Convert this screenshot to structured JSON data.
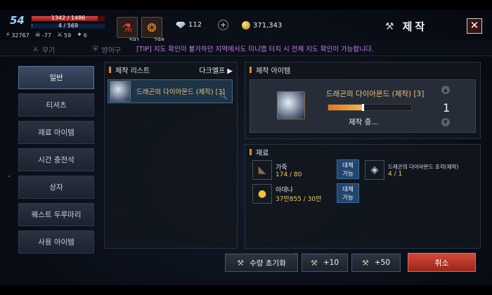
{
  "hud": {
    "level": "54",
    "hp": "1342 / 1486",
    "hp_fraction": 0.903,
    "mp": "4 / 569",
    "mp_fraction": 0.007,
    "stats": [
      {
        "icon": "power-icon",
        "value": "32767"
      },
      {
        "icon": "skull-icon",
        "value": "-77"
      },
      {
        "icon": "sword-icon",
        "value": "59"
      },
      {
        "icon": "wing-icon",
        "value": "6"
      }
    ]
  },
  "quick_slots": [
    {
      "icon": "red-potion-icon",
      "count": "591"
    },
    {
      "icon": "flame-scroll-icon",
      "count": "298"
    }
  ],
  "currency": {
    "diamond": "112",
    "gold": "371,343",
    "plus_label": "+"
  },
  "window": {
    "title": "제작",
    "close_label": "✕"
  },
  "tabs": [
    {
      "label": "무기",
      "icon": "crossed-swords-icon"
    },
    {
      "label": "방어구",
      "icon": "armor-icon"
    }
  ],
  "tip": "[TIP] 지도 확인이 불가하던 지역에서도 미니맵 터치 시 전체 지도 확인이 가능합니다.",
  "menu": [
    {
      "label": "일반",
      "active": true
    },
    {
      "label": "티셔츠",
      "active": false
    },
    {
      "label": "재료 아이템",
      "active": false
    },
    {
      "label": "시간 충전석",
      "active": false
    },
    {
      "label": "상자",
      "active": false
    },
    {
      "label": "퀘스트 두루마리",
      "active": false
    },
    {
      "label": "사용 아이템",
      "active": false
    }
  ],
  "recipe_list": {
    "header": "제작 리스트",
    "sort_label": "다크엘프 ▶",
    "items": [
      {
        "name": "드래곤의 다이아몬드 (제작) [3]"
      }
    ]
  },
  "craft": {
    "header": "제작 아이템",
    "item_name": "드래곤의 다이아몬드 (제작) [3]",
    "progress_fraction": 0.42,
    "status": "제작 중...",
    "quantity": "1"
  },
  "materials": {
    "header": "재료",
    "items": [
      {
        "name": "가죽",
        "count": "174 / 80",
        "button": [
          "대체",
          "가능"
        ]
      },
      {
        "name": "드래곤의 다이아몬드 조각(제작)",
        "count": "4 / 1"
      },
      {
        "name": "아데나",
        "count": "37만855 / 30만",
        "button": [
          "대체",
          "가능"
        ]
      }
    ]
  },
  "buttons": {
    "reset": "수량 초기화",
    "plus10": "+10",
    "plus50": "+50",
    "cancel": "취소"
  },
  "colors": {
    "accent": "#f0c27a",
    "cancel": "#c23a2a",
    "tip": "#c77bf0"
  }
}
